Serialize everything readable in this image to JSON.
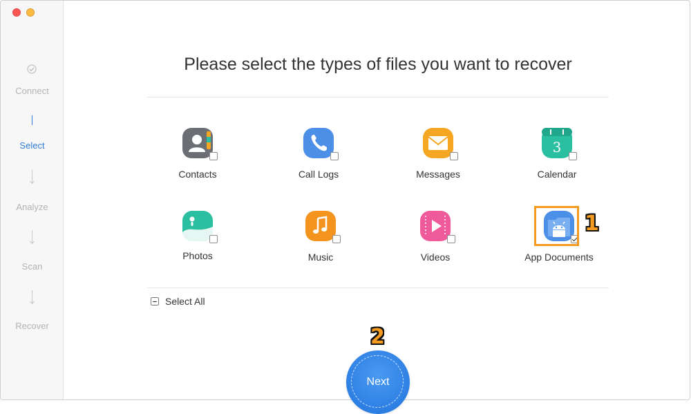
{
  "sidebar": {
    "steps": [
      {
        "label": "Connect",
        "state": "done"
      },
      {
        "label": "Select",
        "state": "active"
      },
      {
        "label": "Analyze",
        "state": "pending"
      },
      {
        "label": "Scan",
        "state": "pending"
      },
      {
        "label": "Recover",
        "state": "pending"
      }
    ]
  },
  "main": {
    "title": "Please select the types of files you want to recover",
    "file_types": [
      {
        "label": "Contacts",
        "icon": "contacts-icon",
        "color": "#6b6e73",
        "checked": false
      },
      {
        "label": "Call Logs",
        "icon": "phone-icon",
        "color": "#4c8fe6",
        "checked": false
      },
      {
        "label": "Messages",
        "icon": "envelope-icon",
        "color": "#f5a623",
        "checked": false
      },
      {
        "label": "Calendar",
        "icon": "calendar-icon",
        "color": "#2bbfa2",
        "checked": false
      },
      {
        "label": "Photos",
        "icon": "photos-icon",
        "color": "#2bbfa2",
        "checked": false
      },
      {
        "label": "Music",
        "icon": "music-note-icon",
        "color": "#f5931f",
        "checked": false
      },
      {
        "label": "Videos",
        "icon": "play-icon",
        "color": "#ef5a9a",
        "checked": false
      },
      {
        "label": "App Documents",
        "icon": "android-folder-icon",
        "color": "#4c8fe6",
        "checked": true
      }
    ],
    "calendar_day": "3",
    "select_all_label": "Select All",
    "next_label": "Next"
  },
  "annotations": {
    "step1": "1",
    "step2": "2",
    "highlight_color": "#f39a1f"
  },
  "colors": {
    "accent": "#2f7fd8",
    "inactive_step": "#b3b3b3"
  }
}
